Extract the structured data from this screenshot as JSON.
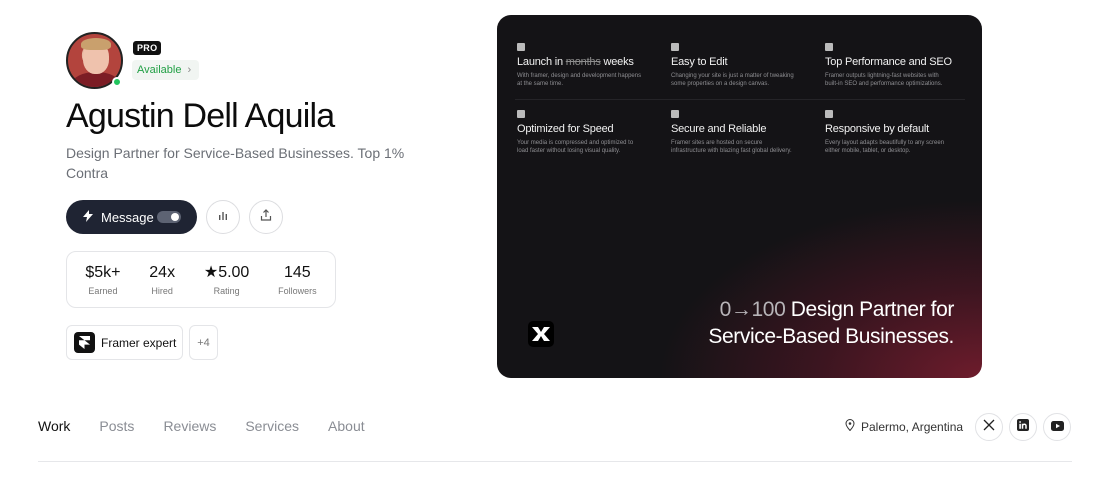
{
  "profile": {
    "pro_badge": "PRO",
    "availability": "Available",
    "availability_chevron": "›",
    "name": "Agustin Dell Aquila",
    "tagline": "Design Partner for Service-Based Businesses. Top 1% Contra",
    "status_color": "#22c55e"
  },
  "actions": {
    "message_label": "Message",
    "message_icon": "bolt-icon",
    "stats_icon": "bar-chart-icon",
    "share_icon": "share-icon"
  },
  "stats": [
    {
      "value": "$5k+",
      "label": "Earned"
    },
    {
      "value": "24x",
      "label": "Hired"
    },
    {
      "value": "★5.00",
      "label": "Rating"
    },
    {
      "value": "145",
      "label": "Followers"
    }
  ],
  "badges": {
    "expert_label": "Framer expert",
    "more_label": "+4"
  },
  "showcase": {
    "features": [
      {
        "title_pre": "Launch in ",
        "title_strike": "months",
        "title_post": " weeks",
        "desc": "With framer, design and development happens at the same time."
      },
      {
        "title_pre": "Easy to Edit",
        "title_strike": "",
        "title_post": "",
        "desc": "Changing your site is just a matter of tweaking some properties on a design canvas."
      },
      {
        "title_pre": "Top Performance and SEO",
        "title_strike": "",
        "title_post": "",
        "desc": "Framer outputs lightning-fast websites with built-in SEO and performance optimizations."
      },
      {
        "title_pre": "Optimized for Speed",
        "title_strike": "",
        "title_post": "",
        "desc": "Your media is compressed and optimized to load faster without losing visual quality."
      },
      {
        "title_pre": "Secure and Reliable",
        "title_strike": "",
        "title_post": "",
        "desc": "Framer sites are hosted on secure infrastructure with blazing fast global delivery."
      },
      {
        "title_pre": "Responsive by default",
        "title_strike": "",
        "title_post": "",
        "desc": "Every layout adapts beautifully to any screen either mobile, tablet, or desktop."
      }
    ],
    "headline_dim": "0→100",
    "headline_line1": " Design Partner for",
    "headline_line2": "Service-Based Businesses."
  },
  "tabs": [
    {
      "label": "Work",
      "active": true
    },
    {
      "label": "Posts",
      "active": false
    },
    {
      "label": "Reviews",
      "active": false
    },
    {
      "label": "Services",
      "active": false
    },
    {
      "label": "About",
      "active": false
    }
  ],
  "location": "Palermo, Argentina",
  "socials": [
    "x-icon",
    "linkedin-icon",
    "youtube-icon"
  ],
  "colors": {
    "message_button": "#1f2433",
    "card_gradient": "#6e1c2c"
  }
}
